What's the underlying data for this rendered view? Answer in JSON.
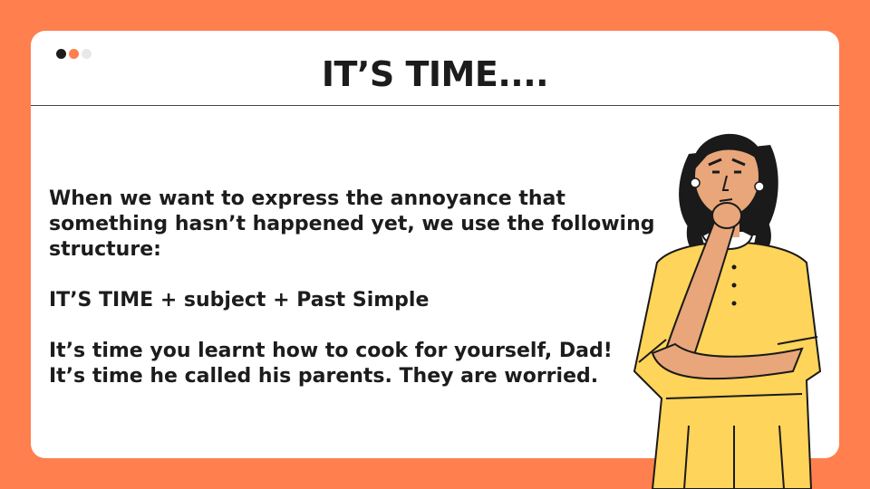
{
  "title": "IT’S TIME....",
  "window_dots": [
    {
      "name": "dot-dark",
      "color": "#1c1c1c"
    },
    {
      "name": "dot-orange",
      "color": "#ff7f4f"
    },
    {
      "name": "dot-light",
      "color": "#e8e8e8"
    }
  ],
  "content": {
    "intro_line1": "When we want to express the annoyance that",
    "intro_line2": "something hasn’t happened yet, we use the following",
    "intro_line3": "structure:",
    "structure": "IT’S TIME + subject + Past Simple",
    "example1": "It’s time you learnt how to cook for yourself, Dad!",
    "example2": "It’s time he called his parents. They are worried."
  },
  "colors": {
    "background": "#ff7f4f",
    "card": "#ffffff",
    "text": "#1c1c1c",
    "dress": "#ffd45a",
    "skin": "#e8a67a",
    "hair": "#1a1a1a"
  },
  "illustration": "thinking-woman-illustration"
}
